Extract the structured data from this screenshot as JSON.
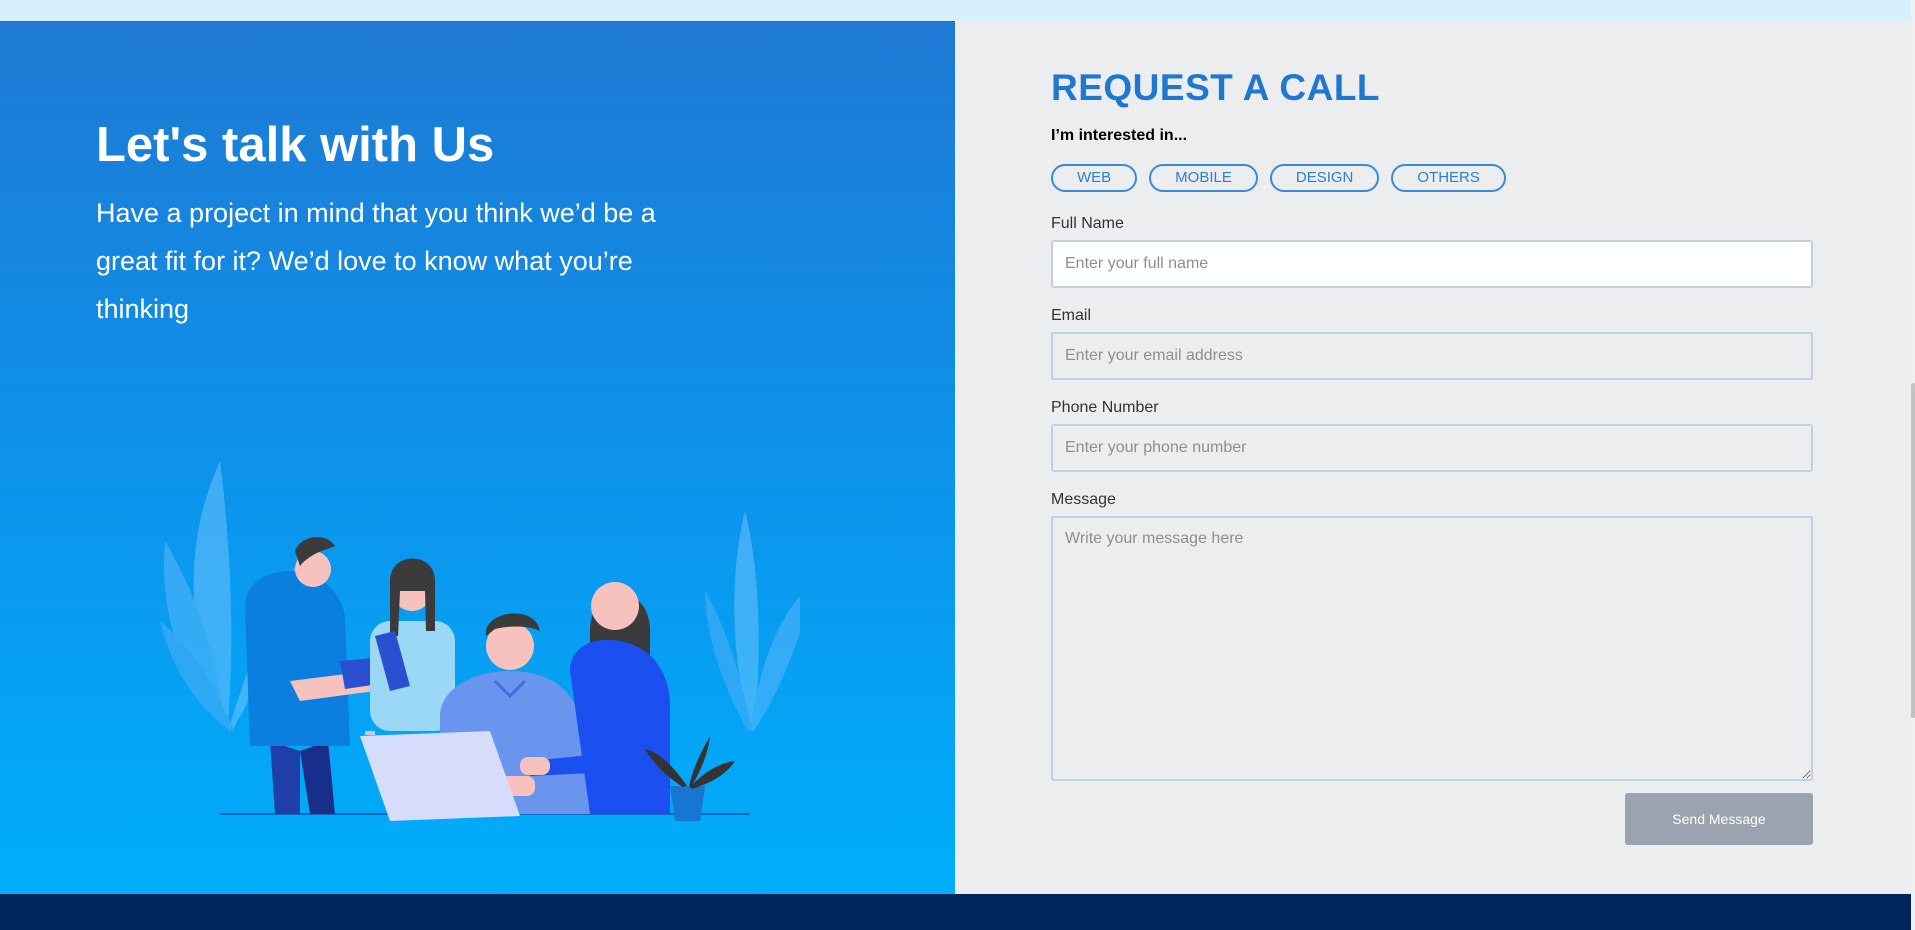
{
  "hero": {
    "title": "Let's talk with Us",
    "text": "Have a project in mind that you think we’d be a great fit for it? We’d love to know what you’re thinking"
  },
  "form": {
    "title": "REQUEST A CALL",
    "interest_label": "I’m interested in...",
    "interests": [
      "WEB",
      "MOBILE",
      "DESIGN",
      "OTHERS"
    ],
    "full_name": {
      "label": "Full Name",
      "placeholder": "Enter your full name",
      "value": ""
    },
    "email": {
      "label": "Email",
      "placeholder": "Enter your email address",
      "value": ""
    },
    "phone": {
      "label": "Phone Number",
      "placeholder": "Enter your phone number",
      "value": ""
    },
    "message": {
      "label": "Message",
      "placeholder": "Write your message here",
      "value": ""
    },
    "submit_label": "Send Message"
  },
  "colors": {
    "accent": "#1f78cf",
    "hero_gradient_top": "#1e79d4",
    "hero_gradient_bottom": "#00aefc",
    "form_background": "#ecedef",
    "button": "#9ba3ae",
    "footer": "#00255a"
  },
  "icons": {
    "illustration": "team-working-at-laptop-illustration",
    "resize": "textarea-resize-handle"
  }
}
